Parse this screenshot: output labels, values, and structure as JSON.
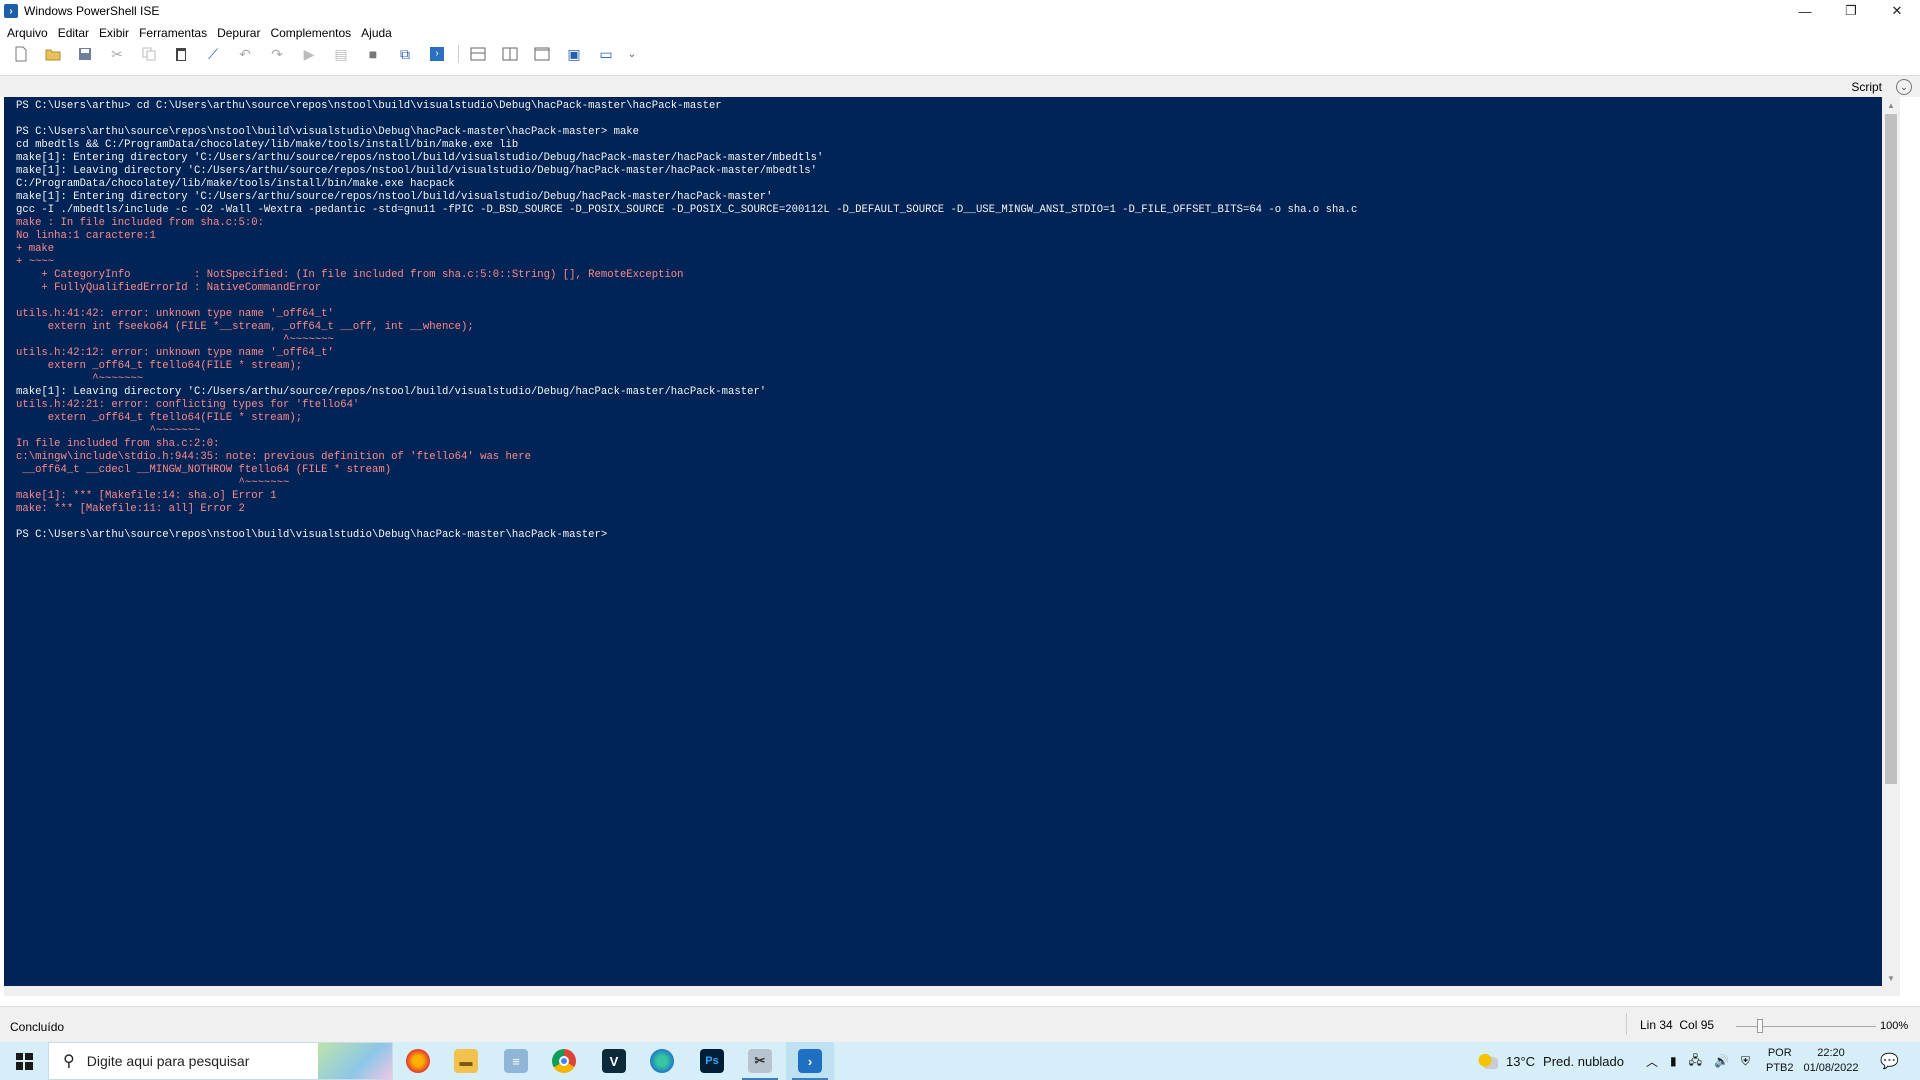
{
  "window": {
    "title": "Windows PowerShell ISE",
    "controls": {
      "minimize": "—",
      "restore": "❐",
      "close": "✕"
    }
  },
  "menu": [
    "Arquivo",
    "Editar",
    "Exibir",
    "Ferramentas",
    "Depurar",
    "Complementos",
    "Ajuda"
  ],
  "toolbar": {
    "icons": [
      "new-script-icon",
      "open-icon",
      "save-icon",
      "cut-icon",
      "copy-icon",
      "paste-icon",
      "clear-console-icon",
      "undo-icon",
      "redo-icon",
      "run-icon",
      "run-selection-icon",
      "stop-icon",
      "remote-powershell-icon",
      "start-powershell-icon",
      "show-script-top-icon",
      "show-script-right-icon",
      "show-script-maximized-icon",
      "show-command-window-icon",
      "show-command-addon-icon"
    ],
    "more": "⌄"
  },
  "script_bar": {
    "label": "Script",
    "toggle": "⌄"
  },
  "console": {
    "lines": [
      {
        "t": "PS C:\\Users\\arthu> cd C:\\Users\\arthu\\source\\repos\\nstool\\build\\visualstudio\\Debug\\hacPack-master\\hacPack-master",
        "c": "white"
      },
      {
        "t": "",
        "c": "white"
      },
      {
        "t": "PS C:\\Users\\arthu\\source\\repos\\nstool\\build\\visualstudio\\Debug\\hacPack-master\\hacPack-master> make",
        "c": "white"
      },
      {
        "t": "cd mbedtls && C:/ProgramData/chocolatey/lib/make/tools/install/bin/make.exe lib",
        "c": "white"
      },
      {
        "t": "make[1]: Entering directory 'C:/Users/arthu/source/repos/nstool/build/visualstudio/Debug/hacPack-master/hacPack-master/mbedtls'",
        "c": "white"
      },
      {
        "t": "make[1]: Leaving directory 'C:/Users/arthu/source/repos/nstool/build/visualstudio/Debug/hacPack-master/hacPack-master/mbedtls'",
        "c": "white"
      },
      {
        "t": "C:/ProgramData/chocolatey/lib/make/tools/install/bin/make.exe hacpack",
        "c": "white"
      },
      {
        "t": "make[1]: Entering directory 'C:/Users/arthu/source/repos/nstool/build/visualstudio/Debug/hacPack-master/hacPack-master'",
        "c": "white"
      },
      {
        "t": "gcc -I ./mbedtls/include -c -O2 -Wall -Wextra -pedantic -std=gnu11 -fPIC -D_BSD_SOURCE -D_POSIX_SOURCE -D_POSIX_C_SOURCE=200112L -D_DEFAULT_SOURCE -D__USE_MINGW_ANSI_STDIO=1 -D_FILE_OFFSET_BITS=64 -o sha.o sha.c",
        "c": "white"
      },
      {
        "t": "make : In file included from sha.c:5:0:",
        "c": "red"
      },
      {
        "t": "No linha:1 caractere:1",
        "c": "red"
      },
      {
        "t": "+ make",
        "c": "red"
      },
      {
        "t": "+ ~~~~",
        "c": "red"
      },
      {
        "t": "    + CategoryInfo          : NotSpecified: (In file included from sha.c:5:0::String) [], RemoteException",
        "c": "red"
      },
      {
        "t": "    + FullyQualifiedErrorId : NativeCommandError",
        "c": "red"
      },
      {
        "t": "",
        "c": "red"
      },
      {
        "t": "utils.h:41:42: error: unknown type name '_off64_t'",
        "c": "red"
      },
      {
        "t": "     extern int fseeko64 (FILE *__stream, _off64_t __off, int __whence);",
        "c": "red"
      },
      {
        "t": "                                          ^~~~~~~~",
        "c": "red"
      },
      {
        "t": "utils.h:42:12: error: unknown type name '_off64_t'",
        "c": "red"
      },
      {
        "t": "     extern _off64_t ftello64(FILE * stream);",
        "c": "red"
      },
      {
        "t": "            ^~~~~~~~",
        "c": "red"
      },
      {
        "t": "make[1]: Leaving directory 'C:/Users/arthu/source/repos/nstool/build/visualstudio/Debug/hacPack-master/hacPack-master'",
        "c": "white"
      },
      {
        "t": "utils.h:42:21: error: conflicting types for 'ftello64'",
        "c": "red"
      },
      {
        "t": "     extern _off64_t ftello64(FILE * stream);",
        "c": "red"
      },
      {
        "t": "                     ^~~~~~~~",
        "c": "red"
      },
      {
        "t": "In file included from sha.c:2:0:",
        "c": "red"
      },
      {
        "t": "c:\\mingw\\include\\stdio.h:944:35: note: previous definition of 'ftello64' was here",
        "c": "red"
      },
      {
        "t": " __off64_t __cdecl __MINGW_NOTHROW ftello64 (FILE * stream)",
        "c": "red"
      },
      {
        "t": "                                   ^~~~~~~~",
        "c": "red"
      },
      {
        "t": "make[1]: *** [Makefile:14: sha.o] Error 1",
        "c": "red"
      },
      {
        "t": "make: *** [Makefile:11: all] Error 2",
        "c": "red"
      },
      {
        "t": "",
        "c": "white"
      },
      {
        "t": "PS C:\\Users\\arthu\\source\\repos\\nstool\\build\\visualstudio\\Debug\\hacPack-master\\hacPack-master>",
        "c": "white"
      }
    ],
    "colors": {
      "background": "#012456",
      "white": "#f5f5f5",
      "red": "#ff8a8a"
    }
  },
  "status": {
    "text": "Concluído",
    "position": "Lin 34  Col 95",
    "zoom": "100%"
  },
  "taskbar": {
    "search_placeholder": "Digite aqui para pesquisar",
    "apps": [
      "firefox-icon",
      "file-explorer-icon",
      "notepad-icon",
      "chrome-icon",
      "vegas-icon",
      "edge-icon",
      "photoshop-icon",
      "snipping-tool-icon",
      "powershell-ise-icon"
    ],
    "weather": {
      "temp": "13°C",
      "desc": "Pred. nublado"
    },
    "lang": {
      "top": "POR",
      "bottom": "PTB2"
    },
    "clock": {
      "time": "22:20",
      "date": "01/08/2022"
    }
  }
}
